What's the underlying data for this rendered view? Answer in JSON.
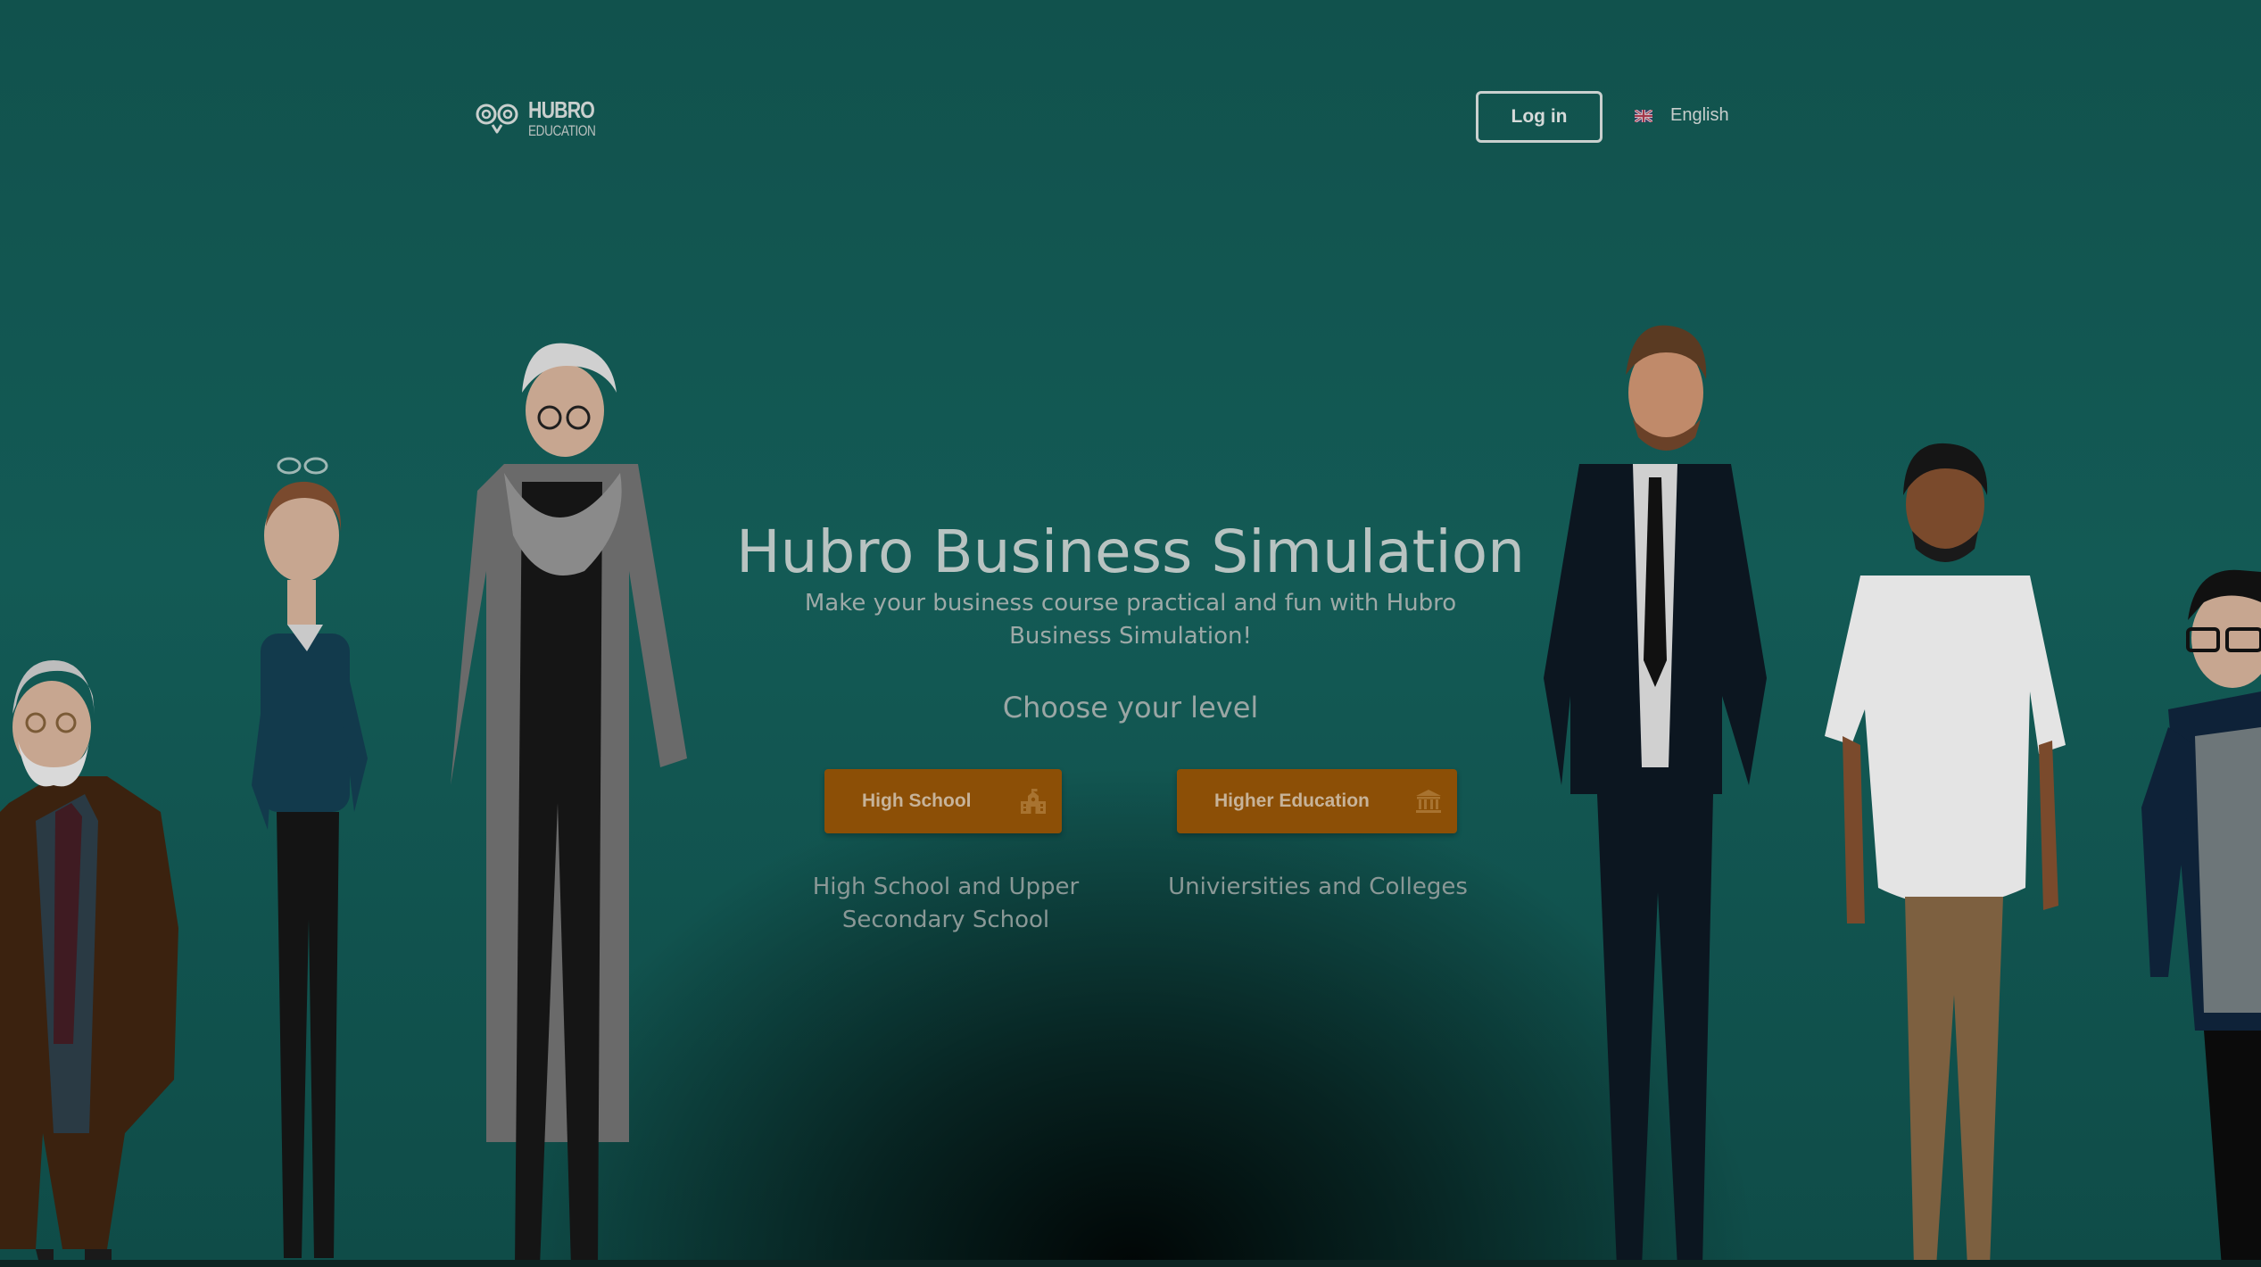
{
  "header": {
    "logo_word1": "HUBRO",
    "logo_word2": "EDUCATION",
    "login_label": "Log in",
    "language_label": "English",
    "language_flag_icon": "uk-flag-icon"
  },
  "hero": {
    "title": "Hubro Business Simulation",
    "subtitle": "Make your business course practical and fun with Hubro Business Simulation!",
    "choose_label": "Choose your level"
  },
  "levels": [
    {
      "label": "High School",
      "icon": "school-building-icon",
      "description": "High School and Upper Secondary School"
    },
    {
      "label": "Higher Education",
      "icon": "university-icon",
      "description": "Univiersities and Colleges"
    }
  ],
  "colors": {
    "background": "#135a55",
    "button_accent": "#8c4f06",
    "text_light": "#b8c3c1"
  }
}
